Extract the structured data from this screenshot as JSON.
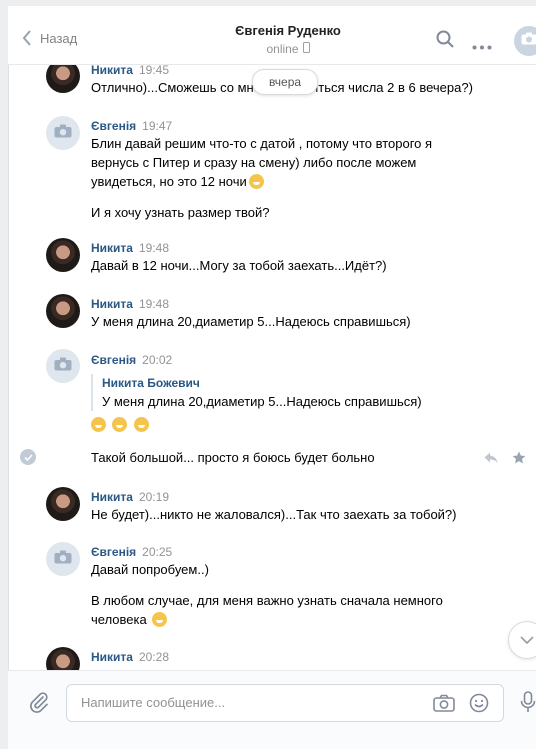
{
  "header": {
    "back_label": "Назад",
    "contact_name": "Євгенія Руденко",
    "status": "online",
    "icons": [
      "chevron-left-icon",
      "search-icon",
      "more-icon",
      "camera-avatar-icon",
      "phone-icon"
    ]
  },
  "date_separator": "вчера",
  "messages": [
    {
      "author": "Никита",
      "time": "19:45",
      "avatar": "photo",
      "lines": [
        "Отлично)...Сможешь со мной встретиться числа 2 в 6 вечера?)"
      ]
    },
    {
      "author": "Євгенія",
      "time": "19:47",
      "avatar": "camera",
      "lines": [
        "Блин давай решим что-то с датой , потому что второго я",
        "вернусь с Питер и сразу на смену) либо после можем",
        "увидеться, но это 12 ночи",
        "",
        "И я хочу узнать размер твой?"
      ]
    },
    {
      "author": "Никита",
      "time": "19:48",
      "avatar": "photo",
      "lines": [
        "Давай в 12 ночи...Могу за тобой заехать...Идёт?)"
      ]
    },
    {
      "author": "Никита",
      "time": "19:48",
      "avatar": "photo",
      "lines": [
        "У меня длина 20,диаметир 5...Надеюсь справишься)"
      ]
    },
    {
      "author": "Євгенія",
      "time": "20:02",
      "avatar": "camera",
      "quote_author": "Никита Божевич",
      "quote_text": "У меня длина 20,диаметир 5...Надеюсь справишься)",
      "emoji_count": 3
    },
    {
      "text": "Такой большой... просто я боюсь будет больно",
      "icons": [
        "checked-icon",
        "reply-icon",
        "star-icon"
      ]
    },
    {
      "author": "Никита",
      "time": "20:19",
      "avatar": "photo",
      "lines": [
        "Не будет)...никто не жаловался)...Так что заехать за тобой?)"
      ]
    },
    {
      "author": "Євгенія",
      "time": "20:25",
      "avatar": "camera",
      "lines": [
        "Давай попробуем..)",
        "",
        "В любом случае, для меня важно узнать сначала немного",
        "человека"
      ]
    },
    {
      "author": "Никита",
      "time": "20:28",
      "avatar": "photo",
      "lines": [
        ""
      ]
    }
  ],
  "composer": {
    "placeholder": "Напишите сообщение...",
    "icons": [
      "paperclip-icon",
      "camera-icon",
      "smile-icon",
      "microphone-icon"
    ]
  },
  "scroll_button_icon": "chevron-down-icon"
}
